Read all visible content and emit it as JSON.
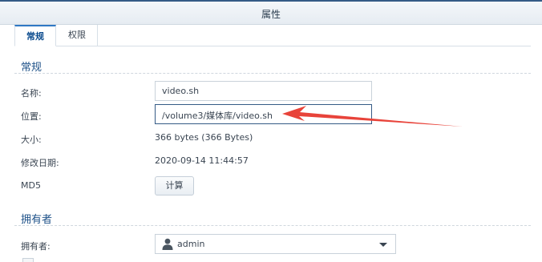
{
  "window": {
    "title": "属性"
  },
  "tabs": [
    {
      "label": "常规",
      "active": true
    },
    {
      "label": "权限",
      "active": false
    }
  ],
  "general": {
    "section_title": "常规",
    "name_label": "名称:",
    "name_value": "video.sh",
    "location_label": "位置:",
    "location_value": "/volume3/媒体库/video.sh",
    "size_label": "大小:",
    "size_value": "366 bytes (366 Bytes)",
    "modified_label": "修改日期:",
    "modified_value": "2020-09-14 11:44:57",
    "md5_label": "MD5",
    "compute_button": "计算"
  },
  "owner": {
    "section_title": "拥有者",
    "owner_label": "拥有者:",
    "owner_value": "admin",
    "owner_icon": "user-icon"
  },
  "colors": {
    "accent": "#1f5289",
    "annotation_arrow": "#e8433a",
    "title_border": "#355b86"
  }
}
